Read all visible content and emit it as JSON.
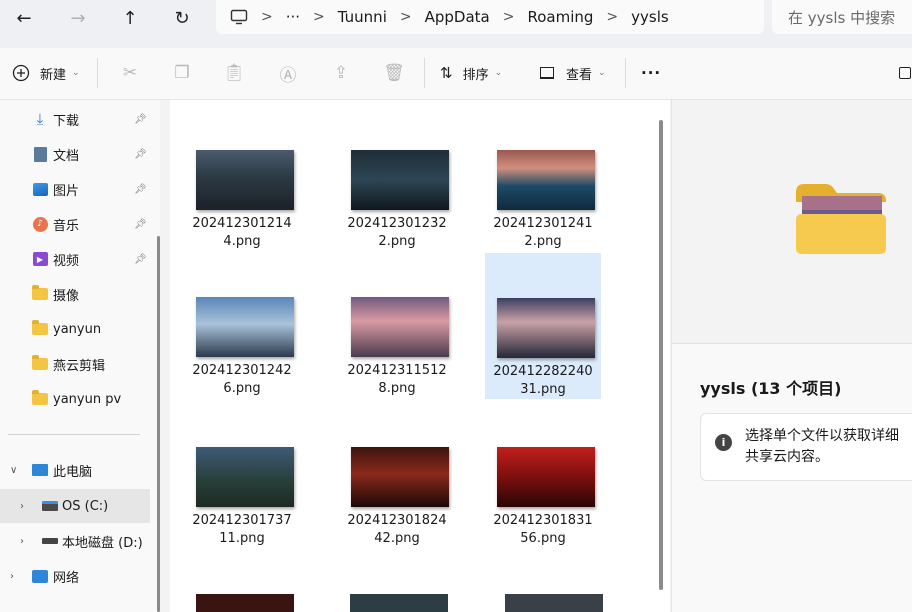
{
  "navigation": {
    "back": "←",
    "forward": "→",
    "up": "↑",
    "refresh": "↻"
  },
  "breadcrumb": {
    "computer_icon": "monitor-icon",
    "ellipsis": "···",
    "parts": [
      "Tuunni",
      "AppData",
      "Roaming",
      "yysls"
    ],
    "separator": ">"
  },
  "search": {
    "placeholder": "在 yysls 中搜索"
  },
  "toolbar": {
    "new_label": "新建",
    "sort_label": "排序",
    "view_label": "查看",
    "more_label": "···"
  },
  "sidebar": {
    "quick_access": [
      {
        "label": "下载",
        "icon": "download-icon",
        "pinned": true
      },
      {
        "label": "文档",
        "icon": "document-icon",
        "pinned": true
      },
      {
        "label": "图片",
        "icon": "pictures-icon",
        "pinned": true
      },
      {
        "label": "音乐",
        "icon": "music-icon",
        "pinned": true
      },
      {
        "label": "视频",
        "icon": "video-icon",
        "pinned": true
      },
      {
        "label": "摄像",
        "icon": "folder-icon",
        "pinned": false
      },
      {
        "label": "yanyun",
        "icon": "folder-icon",
        "pinned": false
      },
      {
        "label": "燕云剪辑",
        "icon": "folder-icon",
        "pinned": false
      },
      {
        "label": "yanyun pv",
        "icon": "folder-icon",
        "pinned": false
      }
    ],
    "this_pc": "此电脑",
    "drives": [
      {
        "label": "OS (C:)",
        "selected": true
      },
      {
        "label": "本地磁盘 (D:)",
        "selected": false
      }
    ],
    "network": "网络"
  },
  "files": [
    {
      "name_line1": "202412301214",
      "name_line2": "4.png",
      "theme": "night-blue",
      "selected": false
    },
    {
      "name_line1": "202412301232",
      "name_line2": "2.png",
      "theme": "dark-teal",
      "selected": false
    },
    {
      "name_line1": "202412301241",
      "name_line2": "2.png",
      "theme": "lake-sunset",
      "selected": false
    },
    {
      "name_line1": "202412301242",
      "name_line2": "6.png",
      "theme": "sky-blue",
      "selected": false
    },
    {
      "name_line1": "202412311512",
      "name_line2": "8.png",
      "theme": "pink-dusk",
      "selected": false
    },
    {
      "name_line1": "202412282240",
      "name_line2": "31.png",
      "theme": "sun-cliff",
      "selected": true
    },
    {
      "name_line1": "202412301737",
      "name_line2": "11.png",
      "theme": "forest-blue",
      "selected": false
    },
    {
      "name_line1": "202412301824",
      "name_line2": "42.png",
      "theme": "dark-red",
      "selected": false
    },
    {
      "name_line1": "202412301831",
      "name_line2": "56.png",
      "theme": "bright-red",
      "selected": false
    }
  ],
  "details": {
    "title": "yysls (13 个项目)",
    "info_line1": "选择单个文件以获取详细",
    "info_line2": "共享云内容。"
  },
  "colors": {
    "accent": "#0067c0",
    "selection": "#dcebfb",
    "folder": "#f4c542"
  }
}
